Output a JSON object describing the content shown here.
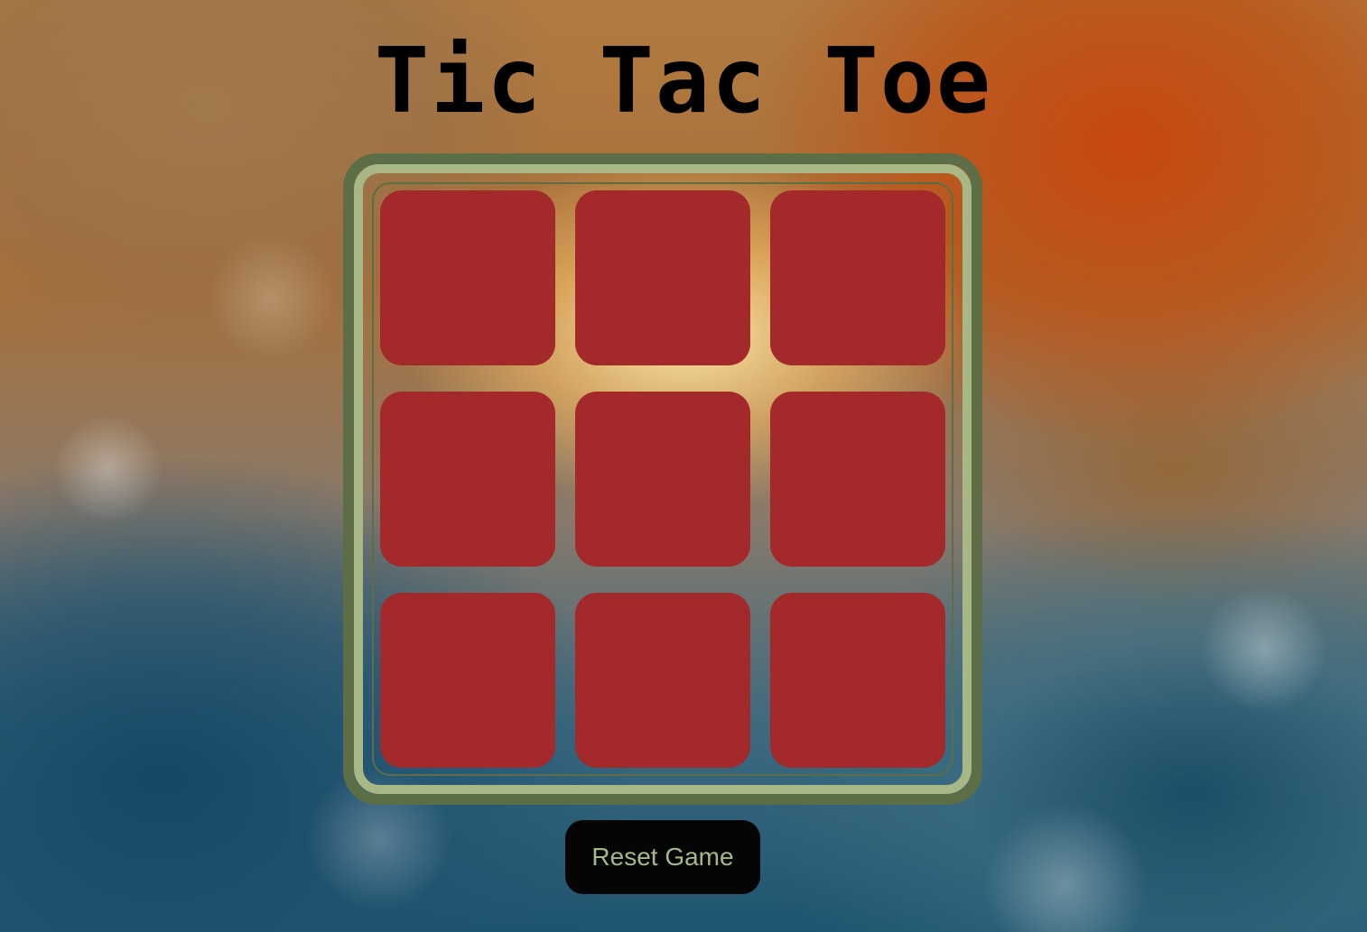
{
  "game": {
    "title": "Tic Tac Toe",
    "board": [
      "",
      "",
      "",
      "",
      "",
      "",
      "",
      "",
      ""
    ],
    "reset_label": "Reset Game"
  },
  "colors": {
    "cell": "#a3292a",
    "frame_outer": "#5c6e46",
    "frame_inner": "#a7b786",
    "button_bg": "#050505",
    "button_text": "#a7b786"
  }
}
